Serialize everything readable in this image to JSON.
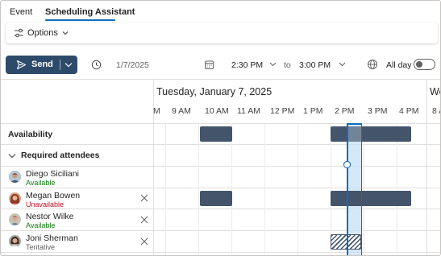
{
  "tabs": [
    {
      "label": "Event"
    },
    {
      "label": "Scheduling Assistant",
      "active": true
    }
  ],
  "options": {
    "label": "Options"
  },
  "toolbar": {
    "send_label": "Send",
    "date": "1/7/2025",
    "start_time": "2:30 PM",
    "to_label": "to",
    "end_time": "3:00 PM",
    "all_day_label": "All day",
    "all_day_on": false
  },
  "timeline": {
    "day_header": "Tuesday, January 7, 2025",
    "next_day_header": "We",
    "times": [
      "M",
      "9 AM",
      "10 AM",
      "11 AM",
      "12 PM",
      "1 PM",
      "2 PM",
      "3 PM",
      "4 PM",
      "8 A"
    ]
  },
  "rows": {
    "availability_label": "Availability",
    "required_label": "Required attendees"
  },
  "attendees": [
    {
      "name": "Diego Siciliani",
      "status": "Available",
      "status_color": "#107c10"
    },
    {
      "name": "Megan Bowen",
      "status": "Unavailable",
      "status_color": "#c50f1f"
    },
    {
      "name": "Nestor Wilke",
      "status": "Available",
      "status_color": "#107c10"
    },
    {
      "name": "Joni Sherman",
      "status": "Tentative",
      "status_color": "#616161"
    }
  ],
  "colors": {
    "accent": "#0f6cbd",
    "busy": "#44546a",
    "send_button": "#2e4a6b",
    "selection": "#c7e0f4"
  },
  "icons": {
    "options": "sliders-icon",
    "send": "paper-plane-icon",
    "time_zone": "clock-icon",
    "calendar": "calendar-icon",
    "all_day": "globe-icon"
  }
}
